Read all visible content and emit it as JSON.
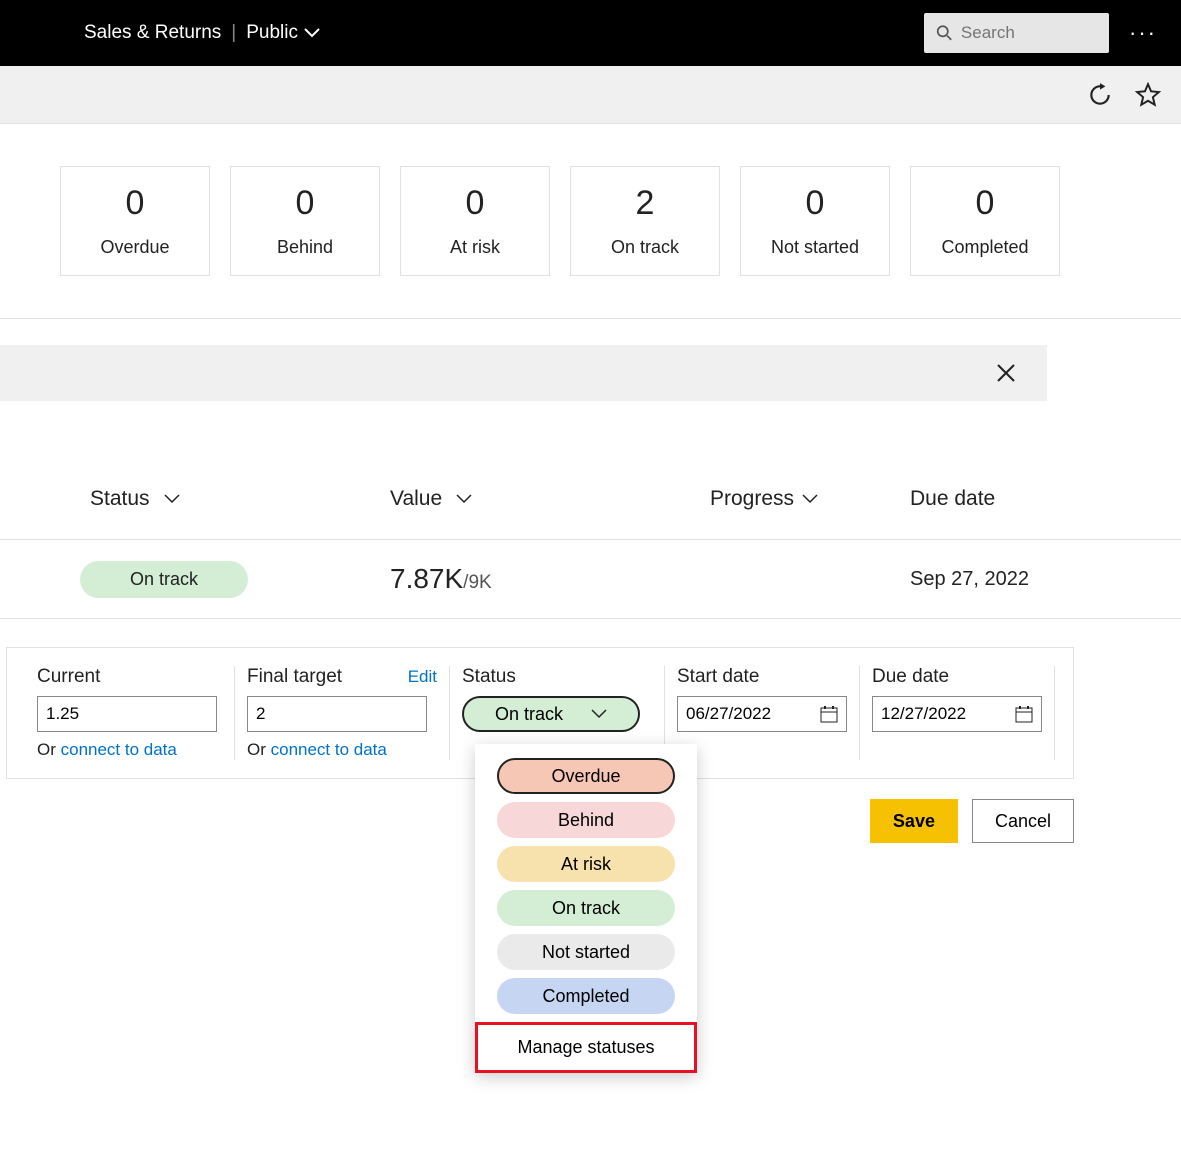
{
  "header": {
    "workspace": "Sales & Returns",
    "visibility": "Public",
    "search_placeholder": "Search"
  },
  "cards": [
    {
      "count": "0",
      "label": "Overdue"
    },
    {
      "count": "0",
      "label": "Behind"
    },
    {
      "count": "0",
      "label": "At risk"
    },
    {
      "count": "2",
      "label": "On track"
    },
    {
      "count": "0",
      "label": "Not started"
    },
    {
      "count": "0",
      "label": "Completed"
    }
  ],
  "columns": {
    "status": "Status",
    "value": "Value",
    "progress": "Progress",
    "due": "Due date"
  },
  "row": {
    "status": "On track",
    "value": "7.87K",
    "target": "/9K",
    "due": "Sep 27, 2022"
  },
  "form": {
    "current": {
      "label": "Current",
      "value": "1.25",
      "hint_prefix": "Or ",
      "hint_link": "connect to data"
    },
    "final_target": {
      "label": "Final target",
      "edit": "Edit",
      "value": "2",
      "hint_prefix": "Or ",
      "hint_link": "connect to data"
    },
    "status": {
      "label": "Status",
      "selected": "On track"
    },
    "start_date": {
      "label": "Start date",
      "value": "06/27/2022"
    },
    "due_date": {
      "label": "Due date",
      "value": "12/27/2022"
    }
  },
  "status_options": {
    "overdue": "Overdue",
    "behind": "Behind",
    "atrisk": "At risk",
    "ontrack": "On track",
    "notstarted": "Not started",
    "completed": "Completed",
    "manage": "Manage statuses"
  },
  "actions": {
    "save": "Save",
    "cancel": "Cancel"
  }
}
